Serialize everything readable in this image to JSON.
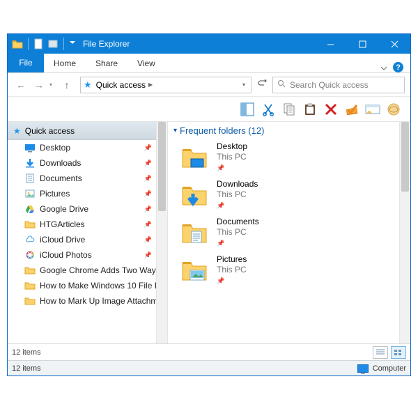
{
  "titlebar": {
    "title": "File Explorer"
  },
  "tabs": {
    "file": "File",
    "home": "Home",
    "share": "Share",
    "view": "View"
  },
  "address": {
    "location": "Quick access",
    "search_placeholder": "Search Quick access"
  },
  "sidebar": {
    "header": "Quick access",
    "items": [
      {
        "label": "Desktop",
        "icon": "desktop",
        "pinned": true
      },
      {
        "label": "Downloads",
        "icon": "downloads",
        "pinned": true
      },
      {
        "label": "Documents",
        "icon": "documents",
        "pinned": true
      },
      {
        "label": "Pictures",
        "icon": "pictures",
        "pinned": true
      },
      {
        "label": "Google Drive",
        "icon": "gdrive",
        "pinned": true
      },
      {
        "label": "HTGArticles",
        "icon": "folder",
        "pinned": true
      },
      {
        "label": "iCloud Drive",
        "icon": "icloud",
        "pinned": true
      },
      {
        "label": "iCloud Photos",
        "icon": "icloudphotos",
        "pinned": true
      },
      {
        "label": "Google Chrome Adds Two Way",
        "icon": "folder",
        "pinned": false
      },
      {
        "label": "How to Make Windows 10 File E",
        "icon": "folder",
        "pinned": false
      },
      {
        "label": "How to Mark Up Image Attachm",
        "icon": "folder",
        "pinned": false
      }
    ]
  },
  "main": {
    "group_title": "Frequent folders (12)",
    "folders": [
      {
        "name": "Desktop",
        "location": "This PC",
        "overlay": "desktop",
        "pinned": true
      },
      {
        "name": "Downloads",
        "location": "This PC",
        "overlay": "downloads",
        "pinned": true
      },
      {
        "name": "Documents",
        "location": "This PC",
        "overlay": "documents",
        "pinned": true
      },
      {
        "name": "Pictures",
        "location": "This PC",
        "overlay": "pictures",
        "pinned": true
      }
    ]
  },
  "status": {
    "items_small": "12 items",
    "items_bar": "12 items",
    "computer": "Computer"
  }
}
